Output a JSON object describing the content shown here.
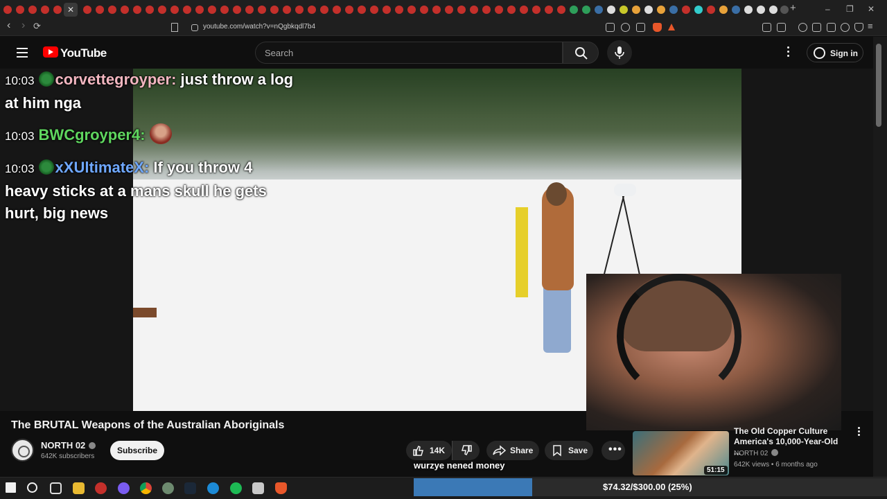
{
  "browser": {
    "url": "youtube.com/watch?v=nQgbkqdl7b4",
    "close_tab_glyph": "✕",
    "new_tab_glyph": "+",
    "window_controls": {
      "minimize": "–",
      "restore": "❐",
      "close": "✕"
    },
    "nav": {
      "back": "‹",
      "forward": "›",
      "reload": "⟳"
    }
  },
  "youtube": {
    "logo_text": "YouTube",
    "search_placeholder": "Search",
    "signin_label": "Sign in"
  },
  "chat": [
    {
      "time": "10:03",
      "user": "corvettegroyper",
      "message": "just throw a log at him nga",
      "color": "#f2b6c0"
    },
    {
      "time": "10:03",
      "user": "BWCgroyper4",
      "message": "",
      "color": "#5fd65f"
    },
    {
      "time": "10:03",
      "user": "xXUltimateX",
      "message": "If you throw 4 heavy sticks at a mans skull he gets hurt, big news",
      "color": "#6fa8ff"
    }
  ],
  "video": {
    "title": "The BRUTAL Weapons of the Australian Aboriginals",
    "channel": "NORTH 02",
    "subscribers": "642K subscribers",
    "subscribe_label": "Subscribe",
    "likes": "14K",
    "share_label": "Share",
    "save_label": "Save"
  },
  "overlay_message": "wurzye nened money",
  "recommendation": {
    "title": "The Old Copper Culture America's 10,000-Year-Old ...",
    "channel": "NORTH 02",
    "views": "642K views",
    "age": "6 months ago",
    "duration": "51:15"
  },
  "donation_goal": {
    "text": "$74.32/$300.00 (25%)",
    "fraction": 0.25,
    "color": "#3b79b6"
  }
}
